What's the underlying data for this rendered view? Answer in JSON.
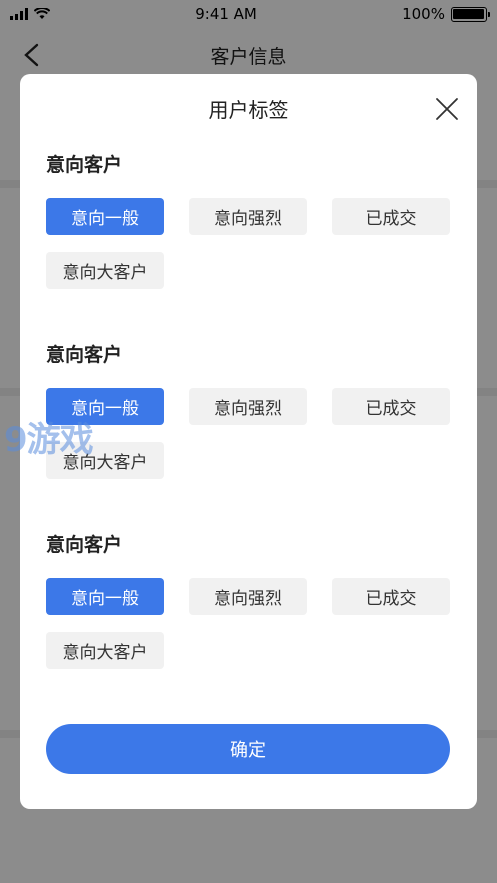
{
  "status_bar": {
    "time": "9:41 AM",
    "battery": "100%"
  },
  "nav": {
    "title": "客户信息",
    "back_icon": "chevron-left-icon"
  },
  "modal": {
    "title": "用户标签",
    "close_icon": "close-icon",
    "groups": [
      {
        "title": "意向客户",
        "tags": [
          {
            "label": "意向一般",
            "selected": true
          },
          {
            "label": "意向强烈",
            "selected": false
          },
          {
            "label": "已成交",
            "selected": false
          },
          {
            "label": "意向大客户",
            "selected": false
          }
        ]
      },
      {
        "title": "意向客户",
        "tags": [
          {
            "label": "意向一般",
            "selected": true
          },
          {
            "label": "意向强烈",
            "selected": false
          },
          {
            "label": "已成交",
            "selected": false
          },
          {
            "label": "意向大客户",
            "selected": false
          }
        ]
      },
      {
        "title": "意向客户",
        "tags": [
          {
            "label": "意向一般",
            "selected": true
          },
          {
            "label": "意向强烈",
            "selected": false
          },
          {
            "label": "已成交",
            "selected": false
          },
          {
            "label": "意向大客户",
            "selected": false
          }
        ]
      }
    ],
    "confirm_label": "确定"
  },
  "watermark": "9游戏",
  "colors": {
    "accent": "#3c78e8",
    "tag_bg": "#f1f1f1"
  }
}
